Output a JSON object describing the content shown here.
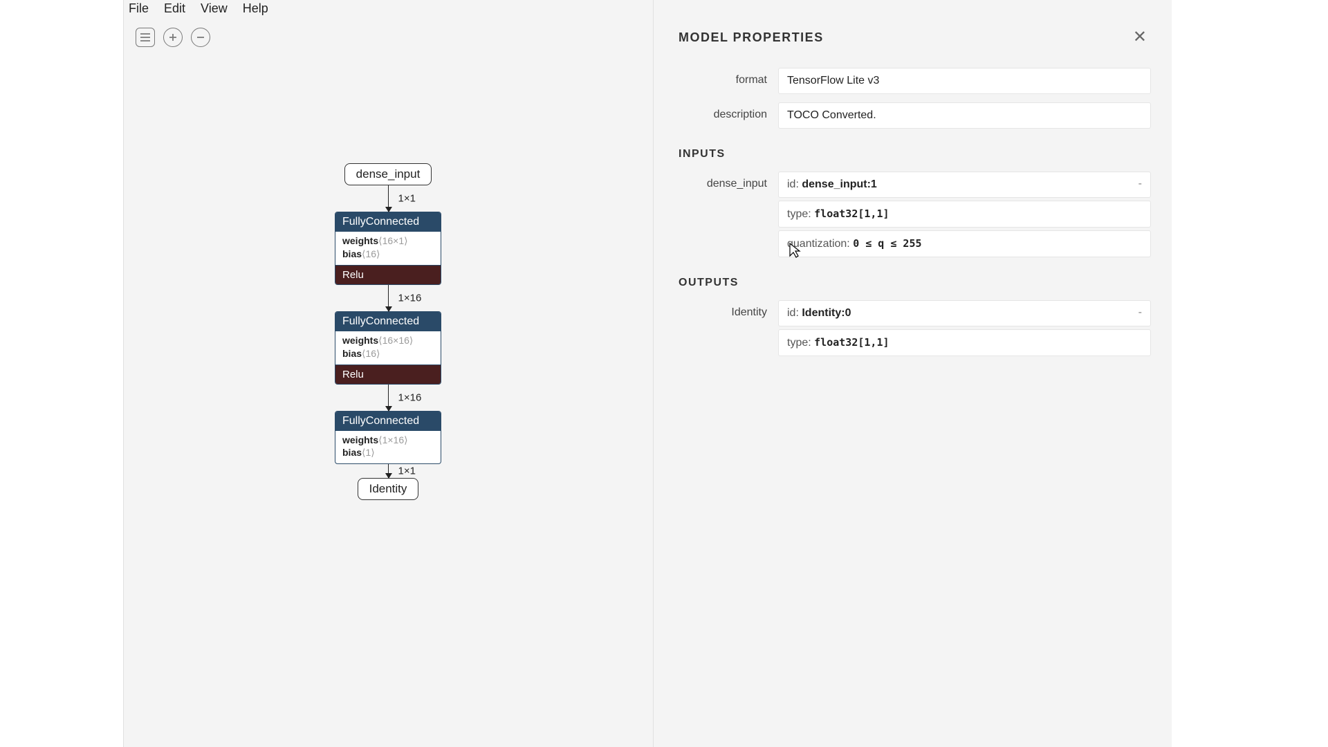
{
  "menu": {
    "file": "File",
    "edit": "Edit",
    "view": "View",
    "help": "Help"
  },
  "graph": {
    "input_node": "dense_input",
    "output_node": "Identity",
    "edges": {
      "e0": "1×1",
      "e1": "1×16",
      "e2": "1×16",
      "e3": "1×1"
    },
    "blocks": [
      {
        "op": "FullyConnected",
        "weights_label": "weights",
        "weights_dim": "⟨16×1⟩",
        "bias_label": "bias",
        "bias_dim": "⟨16⟩",
        "activation": "Relu"
      },
      {
        "op": "FullyConnected",
        "weights_label": "weights",
        "weights_dim": "⟨16×16⟩",
        "bias_label": "bias",
        "bias_dim": "⟨16⟩",
        "activation": "Relu"
      },
      {
        "op": "FullyConnected",
        "weights_label": "weights",
        "weights_dim": "⟨1×16⟩",
        "bias_label": "bias",
        "bias_dim": "⟨1⟩",
        "activation": null
      }
    ]
  },
  "panel": {
    "title": "MODEL PROPERTIES",
    "format_label": "format",
    "format_value": "TensorFlow Lite v3",
    "description_label": "description",
    "description_value": "TOCO Converted.",
    "inputs_heading": "INPUTS",
    "outputs_heading": "OUTPUTS",
    "input": {
      "name": "dense_input",
      "id_label": "id:",
      "id_value": "dense_input:1",
      "type_label": "type:",
      "type_value": "float32[1,1]",
      "quant_label": "quantization:",
      "quant_value": "0 ≤ q ≤ 255"
    },
    "output": {
      "name": "Identity",
      "id_label": "id:",
      "id_value": "Identity:0",
      "type_label": "type:",
      "type_value": "float32[1,1]"
    }
  }
}
